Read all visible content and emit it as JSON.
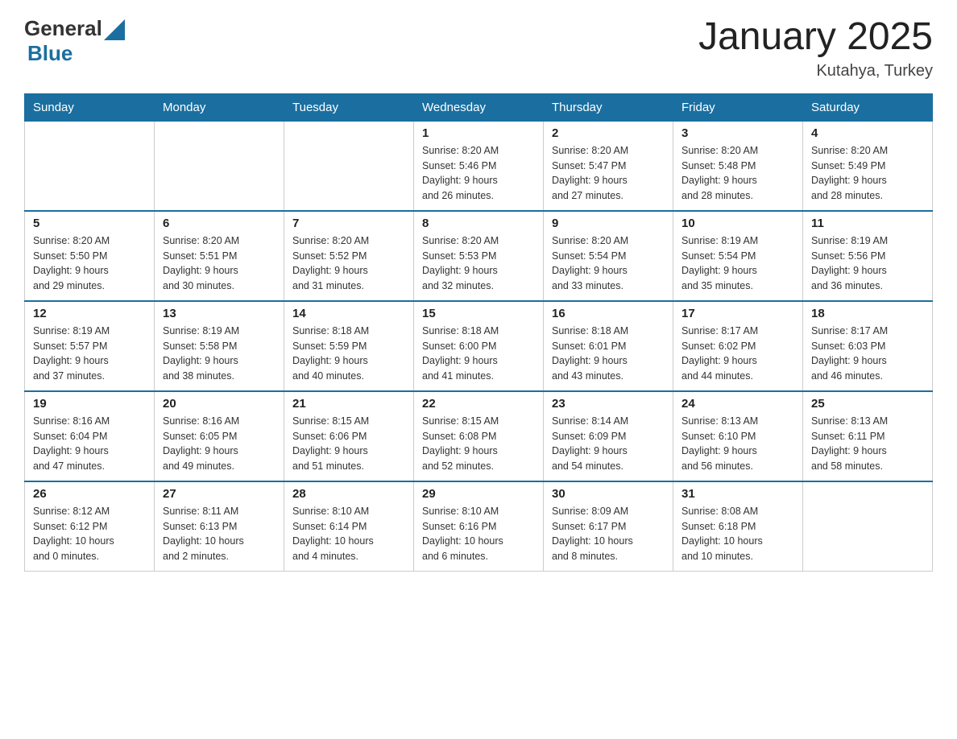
{
  "header": {
    "title": "January 2025",
    "location": "Kutahya, Turkey",
    "logo_general": "General",
    "logo_blue": "Blue"
  },
  "weekdays": [
    "Sunday",
    "Monday",
    "Tuesday",
    "Wednesday",
    "Thursday",
    "Friday",
    "Saturday"
  ],
  "weeks": [
    [
      {
        "day": "",
        "info": ""
      },
      {
        "day": "",
        "info": ""
      },
      {
        "day": "",
        "info": ""
      },
      {
        "day": "1",
        "info": "Sunrise: 8:20 AM\nSunset: 5:46 PM\nDaylight: 9 hours\nand 26 minutes."
      },
      {
        "day": "2",
        "info": "Sunrise: 8:20 AM\nSunset: 5:47 PM\nDaylight: 9 hours\nand 27 minutes."
      },
      {
        "day": "3",
        "info": "Sunrise: 8:20 AM\nSunset: 5:48 PM\nDaylight: 9 hours\nand 28 minutes."
      },
      {
        "day": "4",
        "info": "Sunrise: 8:20 AM\nSunset: 5:49 PM\nDaylight: 9 hours\nand 28 minutes."
      }
    ],
    [
      {
        "day": "5",
        "info": "Sunrise: 8:20 AM\nSunset: 5:50 PM\nDaylight: 9 hours\nand 29 minutes."
      },
      {
        "day": "6",
        "info": "Sunrise: 8:20 AM\nSunset: 5:51 PM\nDaylight: 9 hours\nand 30 minutes."
      },
      {
        "day": "7",
        "info": "Sunrise: 8:20 AM\nSunset: 5:52 PM\nDaylight: 9 hours\nand 31 minutes."
      },
      {
        "day": "8",
        "info": "Sunrise: 8:20 AM\nSunset: 5:53 PM\nDaylight: 9 hours\nand 32 minutes."
      },
      {
        "day": "9",
        "info": "Sunrise: 8:20 AM\nSunset: 5:54 PM\nDaylight: 9 hours\nand 33 minutes."
      },
      {
        "day": "10",
        "info": "Sunrise: 8:19 AM\nSunset: 5:54 PM\nDaylight: 9 hours\nand 35 minutes."
      },
      {
        "day": "11",
        "info": "Sunrise: 8:19 AM\nSunset: 5:56 PM\nDaylight: 9 hours\nand 36 minutes."
      }
    ],
    [
      {
        "day": "12",
        "info": "Sunrise: 8:19 AM\nSunset: 5:57 PM\nDaylight: 9 hours\nand 37 minutes."
      },
      {
        "day": "13",
        "info": "Sunrise: 8:19 AM\nSunset: 5:58 PM\nDaylight: 9 hours\nand 38 minutes."
      },
      {
        "day": "14",
        "info": "Sunrise: 8:18 AM\nSunset: 5:59 PM\nDaylight: 9 hours\nand 40 minutes."
      },
      {
        "day": "15",
        "info": "Sunrise: 8:18 AM\nSunset: 6:00 PM\nDaylight: 9 hours\nand 41 minutes."
      },
      {
        "day": "16",
        "info": "Sunrise: 8:18 AM\nSunset: 6:01 PM\nDaylight: 9 hours\nand 43 minutes."
      },
      {
        "day": "17",
        "info": "Sunrise: 8:17 AM\nSunset: 6:02 PM\nDaylight: 9 hours\nand 44 minutes."
      },
      {
        "day": "18",
        "info": "Sunrise: 8:17 AM\nSunset: 6:03 PM\nDaylight: 9 hours\nand 46 minutes."
      }
    ],
    [
      {
        "day": "19",
        "info": "Sunrise: 8:16 AM\nSunset: 6:04 PM\nDaylight: 9 hours\nand 47 minutes."
      },
      {
        "day": "20",
        "info": "Sunrise: 8:16 AM\nSunset: 6:05 PM\nDaylight: 9 hours\nand 49 minutes."
      },
      {
        "day": "21",
        "info": "Sunrise: 8:15 AM\nSunset: 6:06 PM\nDaylight: 9 hours\nand 51 minutes."
      },
      {
        "day": "22",
        "info": "Sunrise: 8:15 AM\nSunset: 6:08 PM\nDaylight: 9 hours\nand 52 minutes."
      },
      {
        "day": "23",
        "info": "Sunrise: 8:14 AM\nSunset: 6:09 PM\nDaylight: 9 hours\nand 54 minutes."
      },
      {
        "day": "24",
        "info": "Sunrise: 8:13 AM\nSunset: 6:10 PM\nDaylight: 9 hours\nand 56 minutes."
      },
      {
        "day": "25",
        "info": "Sunrise: 8:13 AM\nSunset: 6:11 PM\nDaylight: 9 hours\nand 58 minutes."
      }
    ],
    [
      {
        "day": "26",
        "info": "Sunrise: 8:12 AM\nSunset: 6:12 PM\nDaylight: 10 hours\nand 0 minutes."
      },
      {
        "day": "27",
        "info": "Sunrise: 8:11 AM\nSunset: 6:13 PM\nDaylight: 10 hours\nand 2 minutes."
      },
      {
        "day": "28",
        "info": "Sunrise: 8:10 AM\nSunset: 6:14 PM\nDaylight: 10 hours\nand 4 minutes."
      },
      {
        "day": "29",
        "info": "Sunrise: 8:10 AM\nSunset: 6:16 PM\nDaylight: 10 hours\nand 6 minutes."
      },
      {
        "day": "30",
        "info": "Sunrise: 8:09 AM\nSunset: 6:17 PM\nDaylight: 10 hours\nand 8 minutes."
      },
      {
        "day": "31",
        "info": "Sunrise: 8:08 AM\nSunset: 6:18 PM\nDaylight: 10 hours\nand 10 minutes."
      },
      {
        "day": "",
        "info": ""
      }
    ]
  ]
}
